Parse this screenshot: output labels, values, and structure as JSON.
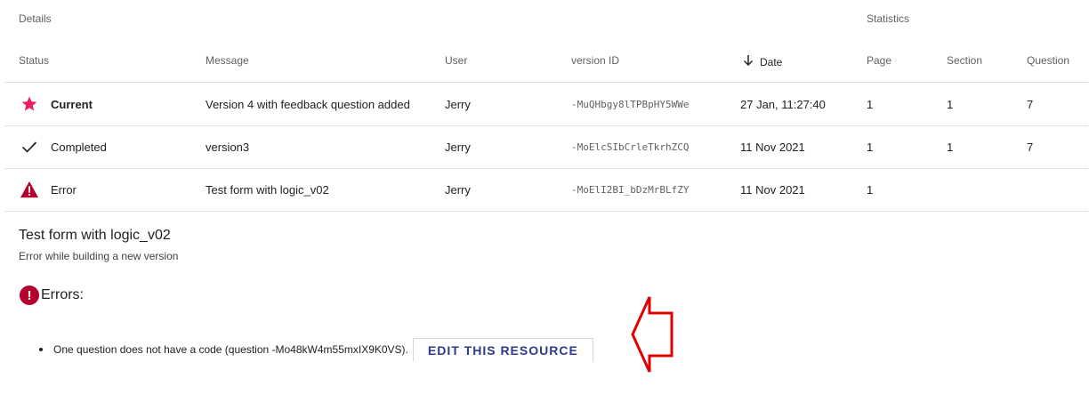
{
  "headers": {
    "details": "Details",
    "statistics": "Statistics",
    "columns": {
      "status": "Status",
      "message": "Message",
      "user": "User",
      "version_id": "version ID",
      "date": "Date",
      "page": "Page",
      "section": "Section",
      "question": "Question"
    }
  },
  "rows": [
    {
      "status": "Current",
      "status_icon": "star-icon",
      "message": "Version 4 with feedback question added",
      "user": "Jerry",
      "version_id": "-MuQHbgy8lTPBpHY5WWe",
      "date": "27 Jan, 11:27:40",
      "page": "1",
      "section": "1",
      "question": "7"
    },
    {
      "status": "Completed",
      "status_icon": "check-icon",
      "message": "version3",
      "user": "Jerry",
      "version_id": "-MoElcSIbCrleTkrhZCQ",
      "date": "11 Nov 2021",
      "page": "1",
      "section": "1",
      "question": "7"
    },
    {
      "status": "Error",
      "status_icon": "warning-icon",
      "message": "Test form with logic_v02",
      "user": "Jerry",
      "version_id": "-MoElI2BI_bDzMrBLfZY",
      "date": "11 Nov 2021",
      "page": "1",
      "section": "",
      "question": ""
    }
  ],
  "detail": {
    "title": "Test form with logic_v02",
    "subtitle": "Error while building a new version",
    "errors_heading": "Errors:",
    "error_item": "One question does not have a code (question -Mo48kW4m55mxIX9K0VS).",
    "edit_button": "EDIT THIS RESOURCE"
  },
  "colors": {
    "star": "#e91e63",
    "error": "#b3002d",
    "button_text": "#2e3a8c",
    "annotation_arrow": "#e00000"
  }
}
